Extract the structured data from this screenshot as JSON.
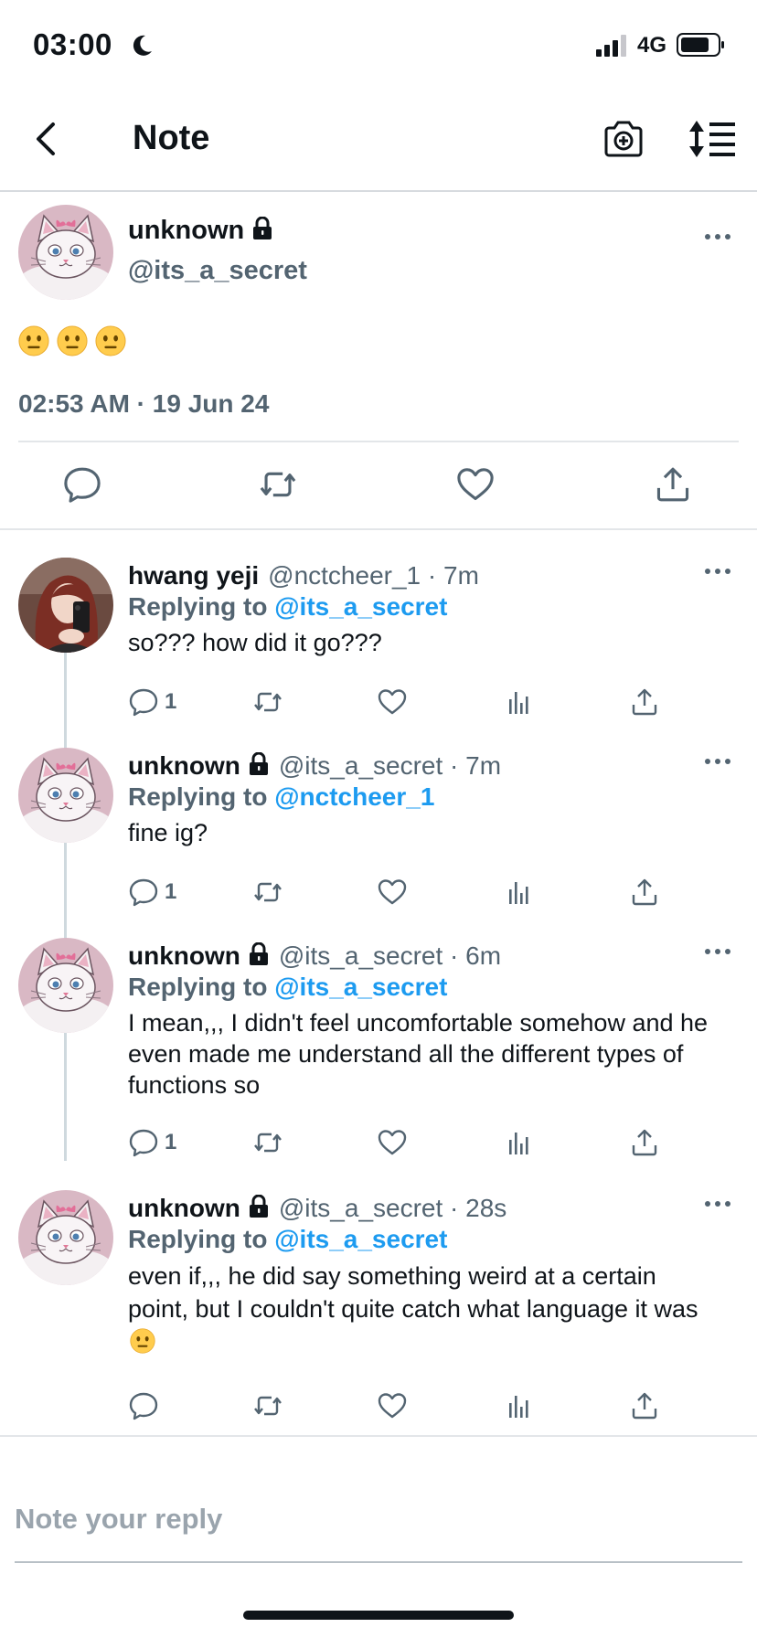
{
  "status_bar": {
    "time": "03:00",
    "network": "4G"
  },
  "header": {
    "title": "Note"
  },
  "main_note": {
    "name": "unknown",
    "handle": "@its_a_secret",
    "body_emoji": [
      "neutral-face-emoji",
      "neutral-face-emoji",
      "neutral-face-emoji"
    ],
    "timestamp": "02:53 AM · 19 Jun 24"
  },
  "replies": [
    {
      "name": "hwang yeji",
      "meta": "@nctcheer_1 · 7m",
      "replying_prefix": "Replying to",
      "replying_to": "@its_a_secret",
      "text": "so??? how did it go???",
      "reply_count": "1",
      "avatar": "girl-photo-avatar"
    },
    {
      "name": "unknown",
      "meta": "@its_a_secret · 7m",
      "replying_prefix": "Replying to",
      "replying_to": "@nctcheer_1",
      "text": "fine ig?",
      "reply_count": "1",
      "avatar": "white-cat-avatar"
    },
    {
      "name": "unknown",
      "meta": "@its_a_secret · 6m",
      "replying_prefix": "Replying to",
      "replying_to": "@its_a_secret",
      "text": "I mean,,, I didn't feel uncomfortable somehow and he even made me understand all the different types of functions so",
      "reply_count": "1",
      "avatar": "white-cat-avatar"
    },
    {
      "name": "unknown",
      "meta": "@its_a_secret · 28s",
      "replying_prefix": "Replying to",
      "replying_to": "@its_a_secret",
      "text": "even if,,, he did say something weird at a certain point, but I couldn't quite catch what language it was",
      "reply_count": "",
      "avatar": "white-cat-avatar"
    }
  ],
  "composer": {
    "placeholder": "Note your reply"
  },
  "colors": {
    "accent": "#1d9bf0",
    "muted": "#536471",
    "text": "#0f1419",
    "divider": "#e3e6e9"
  }
}
